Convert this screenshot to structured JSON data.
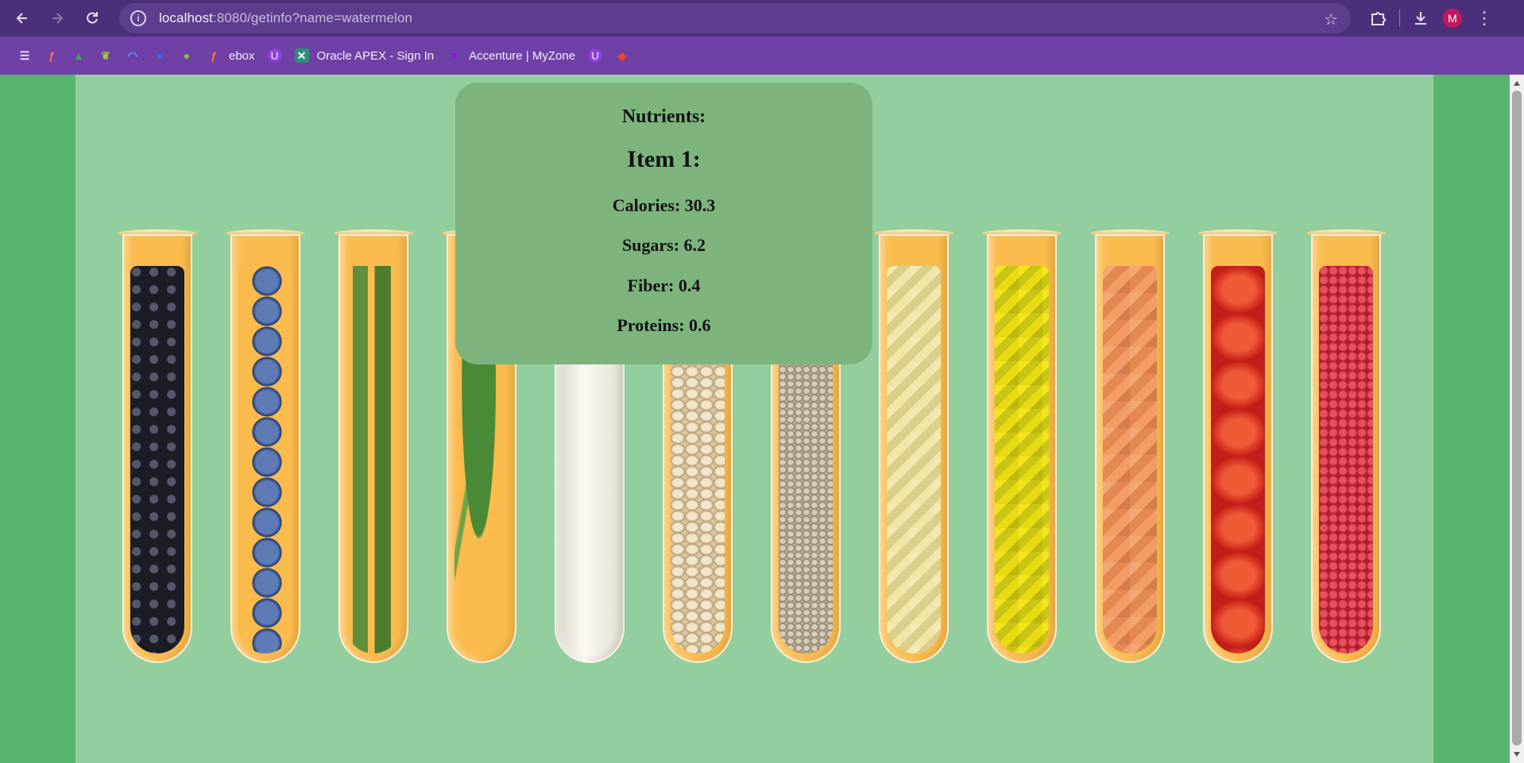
{
  "browser": {
    "url_host": "localhost",
    "url_rest": ":8080/getinfo?name=watermelon",
    "profile_initial": "M"
  },
  "bookmarks": [
    {
      "icon": "apps-grid-icon",
      "label": ""
    },
    {
      "icon": "link-icon",
      "label": ""
    },
    {
      "icon": "drive-icon",
      "label": ""
    },
    {
      "icon": "feather-icon",
      "label": ""
    },
    {
      "icon": "rainbow-icon",
      "label": ""
    },
    {
      "icon": "search-icon",
      "label": ""
    },
    {
      "icon": "fruit-icon",
      "label": ""
    },
    {
      "icon": "link-icon",
      "label": "ebox"
    },
    {
      "icon": "shield-icon",
      "label": ""
    },
    {
      "icon": "apex-icon",
      "label": "Oracle APEX - Sign In"
    },
    {
      "icon": "accenture-icon",
      "label": "Accenture | MyZone"
    },
    {
      "icon": "shield-icon",
      "label": ""
    },
    {
      "icon": "maps-icon",
      "label": ""
    }
  ],
  "popup": {
    "title": "Nutrients:",
    "item": "Item 1:",
    "calories": "Calories: 30.3",
    "sugars": "Sugars: 6.2",
    "fiber": "Fiber: 0.4",
    "proteins": "Proteins: 0.6"
  },
  "tubes": [
    "blackberry",
    "blueberry",
    "asparagus",
    "spinach",
    "milk",
    "oats",
    "rice",
    "pineapple",
    "pepper",
    "salmon",
    "tomato",
    "raspberry"
  ],
  "colors": {
    "toolbar": "#4c2f7a",
    "bookmarks_bar": "#6f40a6",
    "page_bg": "#93cf9e",
    "side_bg": "#57b46e",
    "popup_bg": "#7db47d",
    "tube_bg": "#fbbb4d"
  }
}
